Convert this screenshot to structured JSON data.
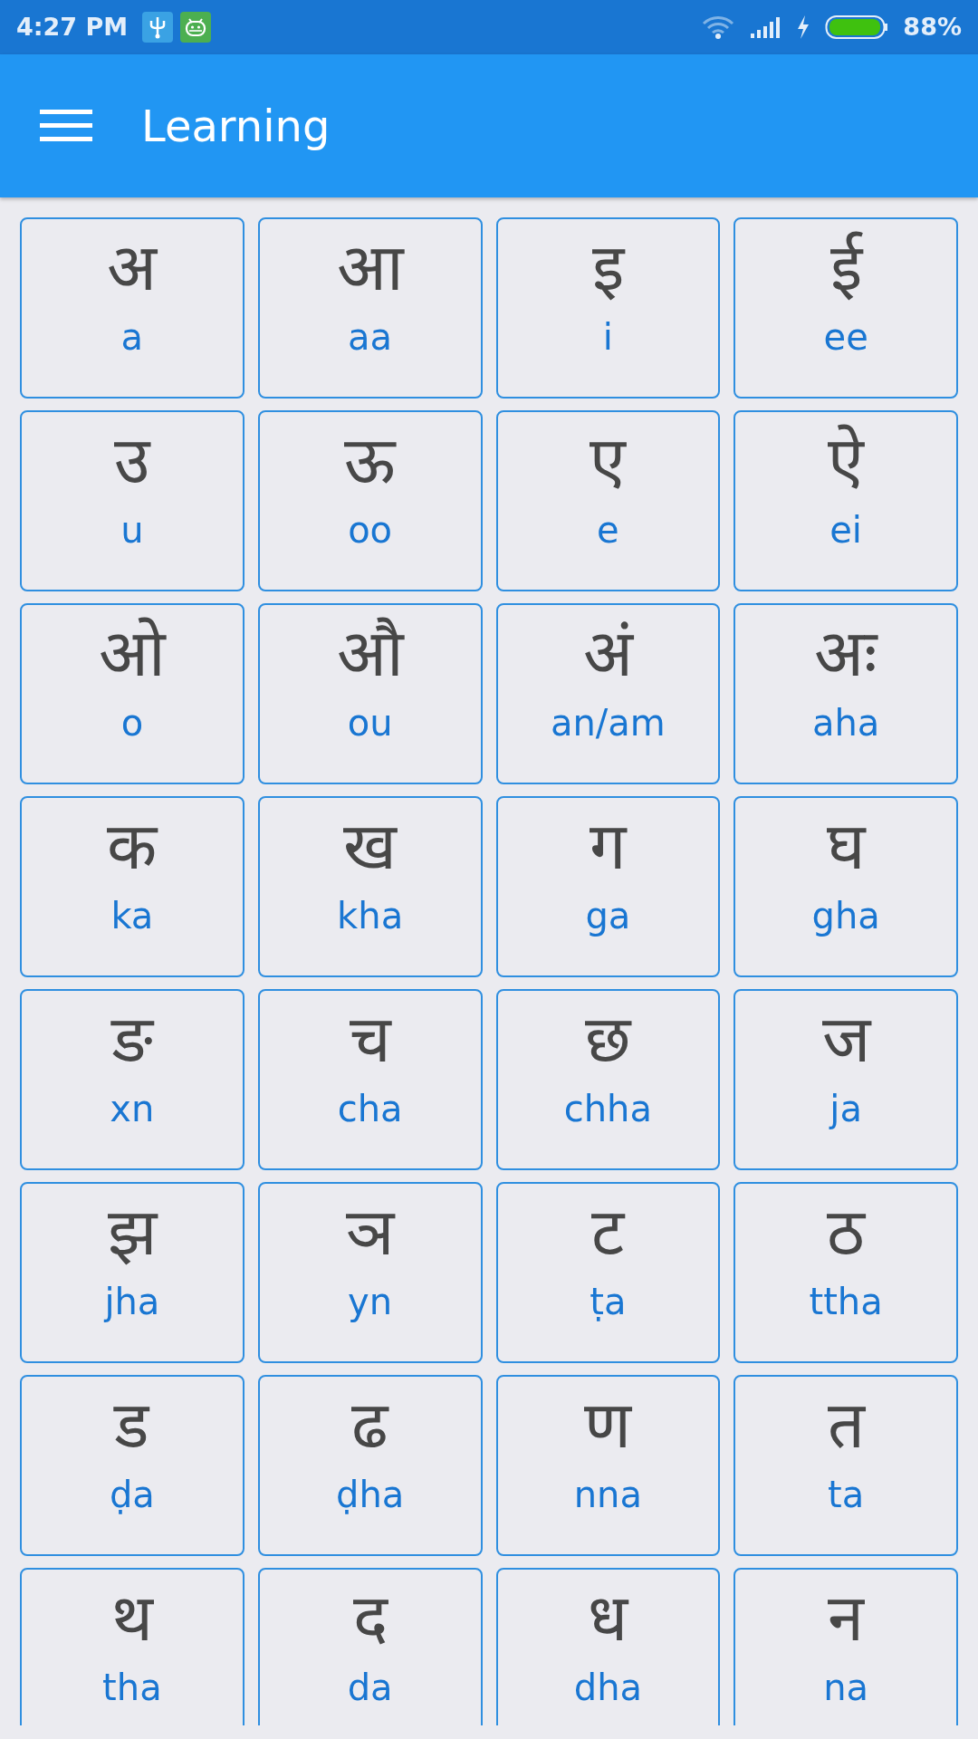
{
  "status_bar": {
    "time": "4:27 PM",
    "battery_text": "88%"
  },
  "app_bar": {
    "title": "Learning"
  },
  "letters": [
    {
      "letter": "अ",
      "translit": "a"
    },
    {
      "letter": "आ",
      "translit": "aa"
    },
    {
      "letter": "इ",
      "translit": "i"
    },
    {
      "letter": "ई",
      "translit": "ee"
    },
    {
      "letter": "उ",
      "translit": "u"
    },
    {
      "letter": "ऊ",
      "translit": "oo"
    },
    {
      "letter": "ए",
      "translit": "e"
    },
    {
      "letter": "ऐ",
      "translit": "ei"
    },
    {
      "letter": "ओ",
      "translit": "o"
    },
    {
      "letter": "औ",
      "translit": "ou"
    },
    {
      "letter": "अं",
      "translit": "an/am"
    },
    {
      "letter": "अः",
      "translit": "aha"
    },
    {
      "letter": "क",
      "translit": "ka"
    },
    {
      "letter": "ख",
      "translit": "kha"
    },
    {
      "letter": "ग",
      "translit": "ga"
    },
    {
      "letter": "घ",
      "translit": "gha"
    },
    {
      "letter": "ङ",
      "translit": "xn"
    },
    {
      "letter": "च",
      "translit": "cha"
    },
    {
      "letter": "छ",
      "translit": "chha"
    },
    {
      "letter": "ज",
      "translit": "ja"
    },
    {
      "letter": "झ",
      "translit": "jha"
    },
    {
      "letter": "ञ",
      "translit": "yn"
    },
    {
      "letter": "ट",
      "translit": "ṭa"
    },
    {
      "letter": "ठ",
      "translit": "ttha"
    },
    {
      "letter": "ड",
      "translit": "ḍa"
    },
    {
      "letter": "ढ",
      "translit": "ḍha"
    },
    {
      "letter": "ण",
      "translit": "nna"
    },
    {
      "letter": "त",
      "translit": "ta"
    },
    {
      "letter": "थ",
      "translit": "tha"
    },
    {
      "letter": "द",
      "translit": "da"
    },
    {
      "letter": "ध",
      "translit": "dha"
    },
    {
      "letter": "न",
      "translit": "na"
    }
  ]
}
